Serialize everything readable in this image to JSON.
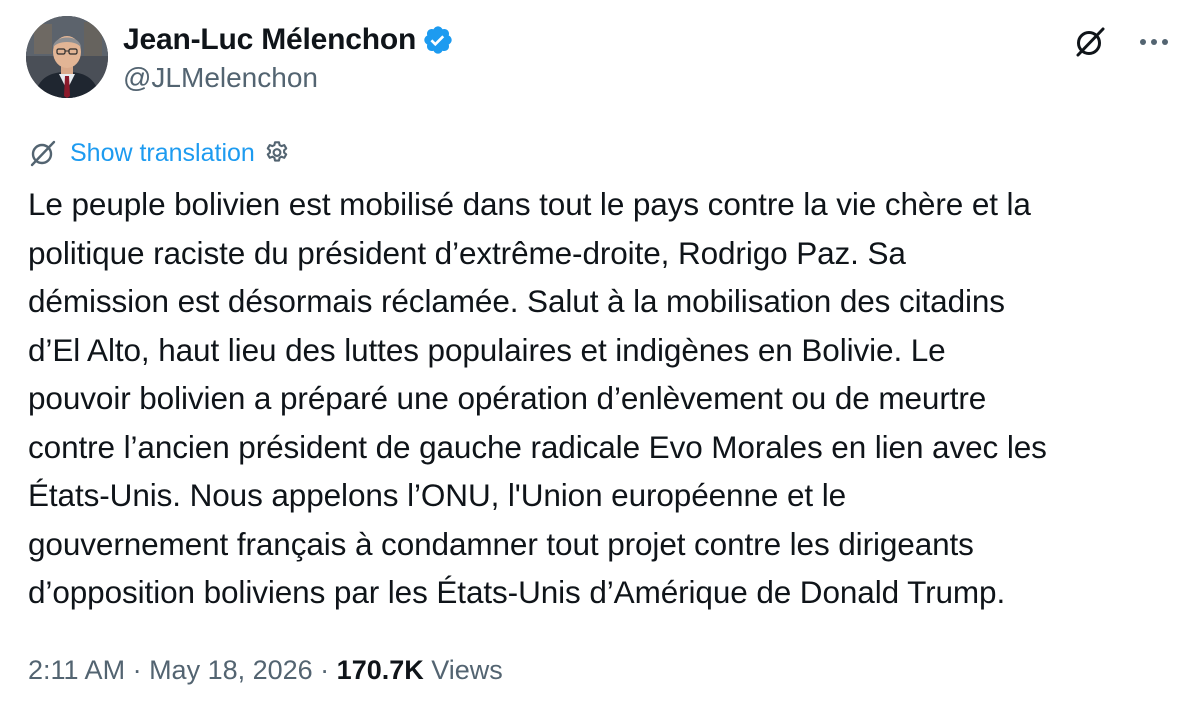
{
  "author": {
    "display_name": "Jean-Luc Mélenchon",
    "handle": "@JLMelenchon",
    "verified_badge_color": "#1d9bf0"
  },
  "icons": {
    "grok": "grok-icon",
    "more": "more-options-icon",
    "translate": "translate-icon",
    "settings": "settings-gear-icon"
  },
  "translation": {
    "label": "Show translation",
    "color": "#1d9bf0"
  },
  "tweet": {
    "text": "Le peuple bolivien est mobilisé dans tout le pays contre la vie chère et la\npolitique raciste du président d’extrême-droite, Rodrigo Paz. Sa\ndémission est désormais réclamée. Salut à la mobilisation des citadins\nd’El Alto, haut lieu des luttes populaires et indigènes en Bolivie. Le\npouvoir bolivien a préparé une opération d’enlèvement ou de meurtre\ncontre l’ancien président de gauche radicale Evo Morales en lien avec les\nÉtats-Unis. Nous appelons l’ONU, l'Union européenne et le\ngouvernement français à condamner tout projet contre les dirigeants\nd’opposition boliviens par les États-Unis d’Amérique de Donald Trump."
  },
  "meta": {
    "time": "2:11 AM",
    "separator": " · ",
    "date": "May 18, 2026",
    "views_count": "170.7K",
    "views_label": "Views"
  },
  "colors": {
    "text_primary": "#0f1419",
    "text_secondary": "#536471",
    "accent": "#1d9bf0"
  }
}
